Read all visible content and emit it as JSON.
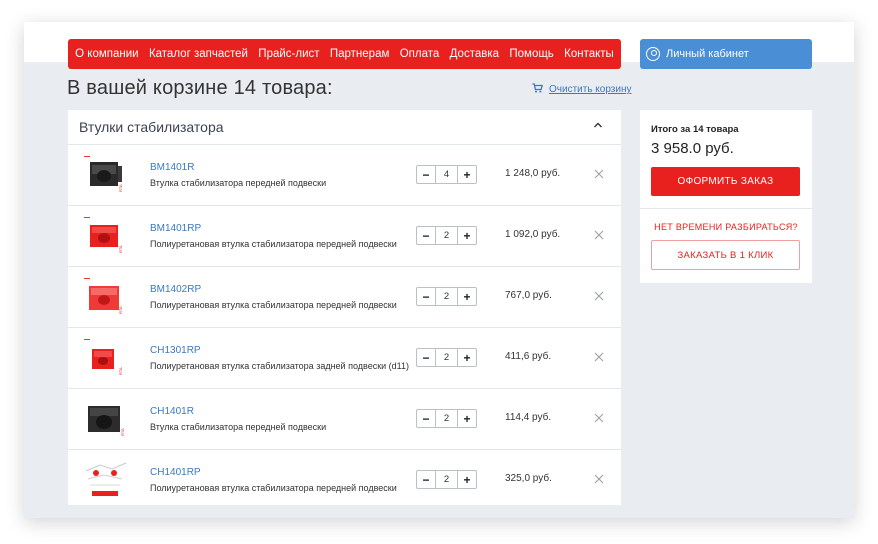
{
  "nav": {
    "items": [
      "О компании",
      "Каталог запчастей",
      "Прайс-лист",
      "Партнерам",
      "Оплата",
      "Доставка",
      "Помощь",
      "Контакты"
    ]
  },
  "account": {
    "label": "Личный кабинет"
  },
  "cart": {
    "title": "В вашей корзине 14 товара:",
    "clear_label": "Очистить корзину"
  },
  "category": {
    "name": "Втулки стабилизатора"
  },
  "items": [
    {
      "code": "BM1401R",
      "name": "Втулка стабилизатора передней подвески",
      "qty": "4",
      "price": "1 248,0 руб."
    },
    {
      "code": "BM1401RP",
      "name": "Полиуретановая втулка стабилизатора передней подвески",
      "qty": "2",
      "price": "1 092,0 руб."
    },
    {
      "code": "BM1402RP",
      "name": "Полиуретановая втулка стабилизатора передней подвески",
      "qty": "2",
      "price": "767,0 руб."
    },
    {
      "code": "CH1301RP",
      "name": "Полиуретановая втулка стабилизатора задней подвески (d11)",
      "qty": "2",
      "price": "411,6 руб."
    },
    {
      "code": "CH1401R",
      "name": "Втулка стабилизатора передней подвески",
      "qty": "2",
      "price": "114,4 руб."
    },
    {
      "code": "CH1401RP",
      "name": "Полиуретановая втулка стабилизатора передней подвески",
      "qty": "2",
      "price": "325,0 руб."
    }
  ],
  "summary": {
    "total_label": "Итого за 14 товара",
    "total_value": "3 958.0 руб.",
    "checkout_label": "ОФОРМИТЬ ЗАКАЗ",
    "no_time_label": "НЕТ ВРЕМЕНИ РАЗБИРАТЬСЯ?",
    "one_click_label": "ЗАКАЗАТЬ В 1 КЛИК"
  },
  "colors": {
    "accent_red": "#e8201e",
    "accent_blue": "#4a8fd6",
    "link_blue": "#3a78c2",
    "background": "#e9edf2"
  }
}
